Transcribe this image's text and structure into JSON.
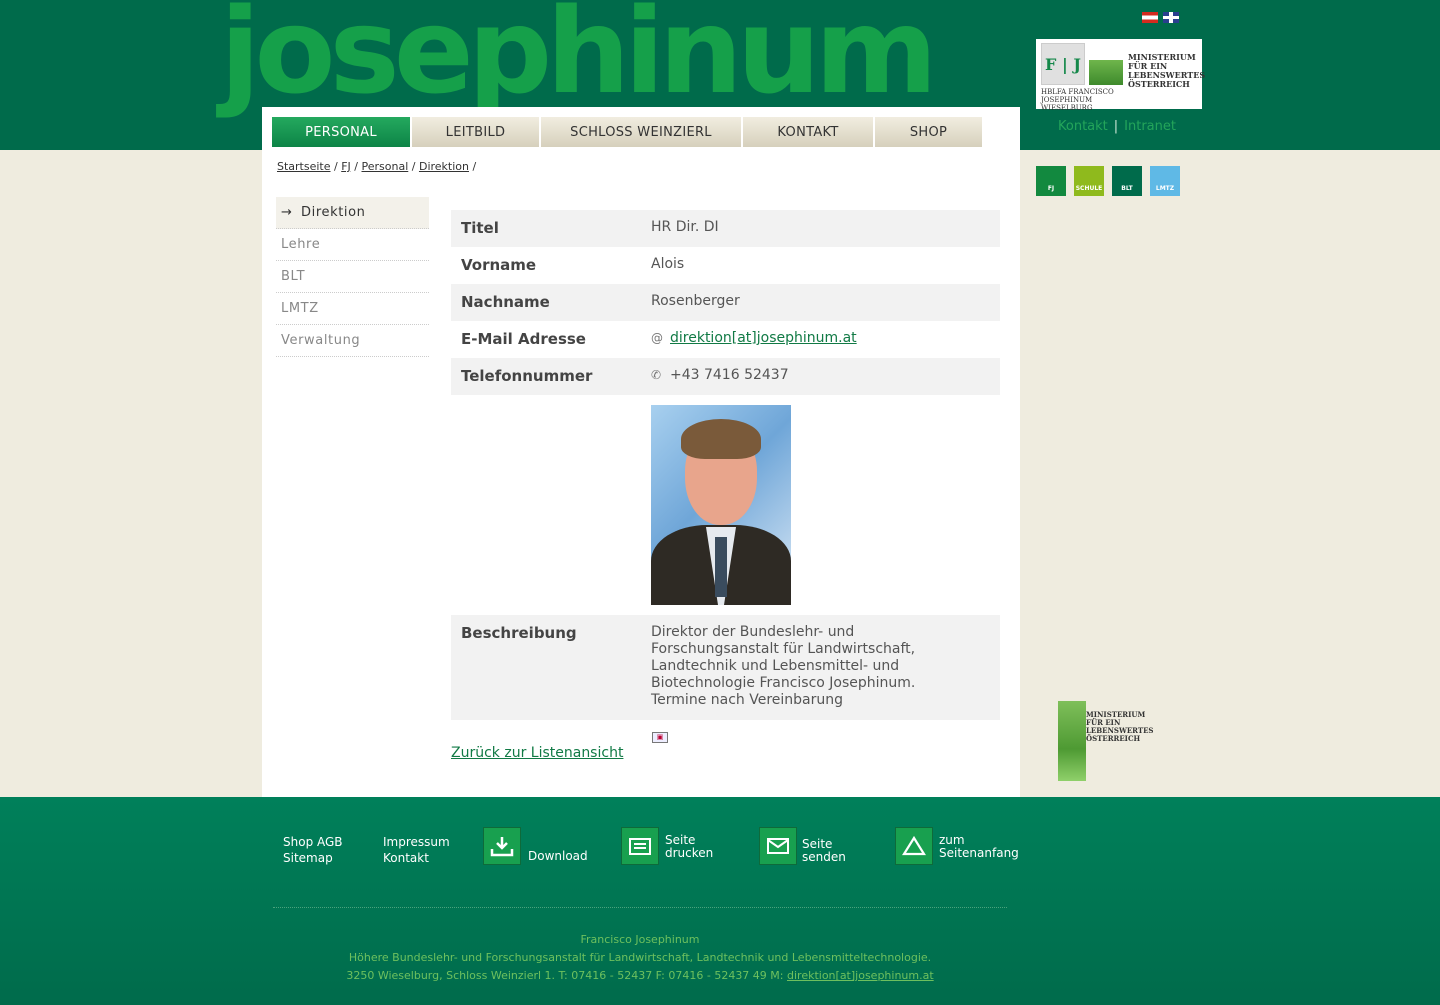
{
  "header": {
    "logo_text": "josephinum",
    "ministry_box": {
      "fj_letters": "F | J",
      "ministry_text": "MINISTERIUM FÜR EIN LEBENSWERTES ÖSTERREICH",
      "school_text": "HBLFA FRANCISCO JOSEPHINUM WIESELBURG"
    },
    "toplinks": {
      "kontakt": "Kontakt",
      "separator": "|",
      "intranet": "Intranet"
    },
    "nav": [
      {
        "label": "PERSONAL",
        "active": true
      },
      {
        "label": "LEITBILD",
        "active": false
      },
      {
        "label": "SCHLOSS WEINZIERL",
        "active": false
      },
      {
        "label": "KONTAKT",
        "active": false
      },
      {
        "label": "SHOP",
        "active": false
      }
    ]
  },
  "breadcrumb": [
    "Startseite",
    "FJ",
    "Personal",
    "Direktion"
  ],
  "subnav": [
    {
      "label": "Direktion",
      "active": true
    },
    {
      "label": "Lehre",
      "active": false
    },
    {
      "label": "BLT",
      "active": false
    },
    {
      "label": "LMTZ",
      "active": false
    },
    {
      "label": "Verwaltung",
      "active": false
    }
  ],
  "detail": {
    "titel_label": "Titel",
    "titel_value": "HR Dir. DI",
    "vorname_label": "Vorname",
    "vorname_value": "Alois",
    "nachname_label": "Nachname",
    "nachname_value": "Rosenberger",
    "email_label": "E-Mail Adresse",
    "email_value": "direktion[at]josephinum.at",
    "telefon_label": "Telefonnummer",
    "telefon_value": "+43 7416 52437",
    "beschreibung_label": "Beschreibung",
    "beschreibung_value": "Direktor der Bundeslehr- und Forschungsanstalt für Landwirtschaft, Landtechnik und Lebensmittel- und Biotechnologie Francisco Josephinum. Termine nach Vereinbarung"
  },
  "back_link": "Zurück zur Listenansicht",
  "side_squares": [
    {
      "label": "FJ",
      "color": "#12893f"
    },
    {
      "label": "SCHULE",
      "color": "#8fba1d"
    },
    {
      "label": "BLT",
      "color": "#006b4b"
    },
    {
      "label": "LMTZ",
      "color": "#5fb9e6"
    }
  ],
  "ministry_bottom_text": "MINISTERIUM FÜR EIN LEBENSWERTES ÖSTERREICH",
  "footer": {
    "col1": [
      "Shop AGB",
      "Sitemap"
    ],
    "col2": [
      "Impressum",
      "Kontakt"
    ],
    "download": "Download",
    "print_1": "Seite",
    "print_2": "drucken",
    "send_1": "Seite",
    "send_2": "senden",
    "top_1": "zum",
    "top_2": "Seitenanfang",
    "info_line1": "Francisco Josephinum",
    "info_line2": "Höhere Bundeslehr- und Forschungsanstalt für Landwirtschaft, Landtechnik und Lebensmitteltechnologie.",
    "info_line3": "3250 Wieselburg, Schloss Weinzierl 1.  T: 07416 - 52437  F: 07416 - 52437 49  M:",
    "info_email": "direktion[at]josephinum.at"
  },
  "colors": {
    "brand_green": "#006b4b",
    "accent_green": "#15a04a",
    "link_green": "#117a45",
    "cream": "#efecdf"
  }
}
